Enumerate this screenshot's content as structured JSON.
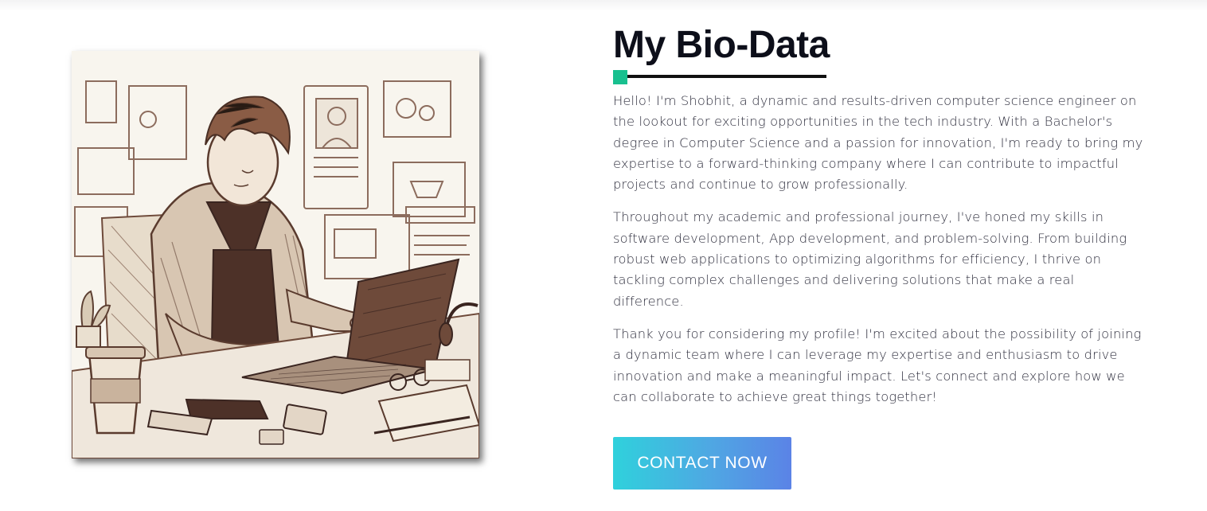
{
  "bio": {
    "title": "My Bio-Data",
    "accent_color": "#18c08f",
    "paragraphs": [
      "Hello! I'm Shobhit, a dynamic and results-driven computer science engineer on the lookout for exciting opportunities in the tech industry. With a Bachelor's degree in Computer Science and a passion for innovation, I'm ready to bring my expertise to a forward-thinking company where I can contribute to impactful projects and continue to grow professionally.",
      "Throughout my academic and professional journey, I've honed my skills in software development, App development, and problem-solving. From building robust web applications to optimizing algorithms for efficiency, I thrive on tackling complex challenges and delivering solutions that make a real difference.",
      "Thank you for considering my profile! I'm excited about the possibility of joining a dynamic team where I can leverage my expertise and enthusiasm to drive innovation and make a meaningful impact. Let's connect and explore how we can collaborate to achieve great things together!"
    ],
    "cta_label": "CONTACT NOW"
  },
  "portrait": {
    "icon": "sketch-illustration-person-coding-on-laptop",
    "ink_color": "#6e4a3a",
    "paper_color": "#f8f5ee"
  }
}
